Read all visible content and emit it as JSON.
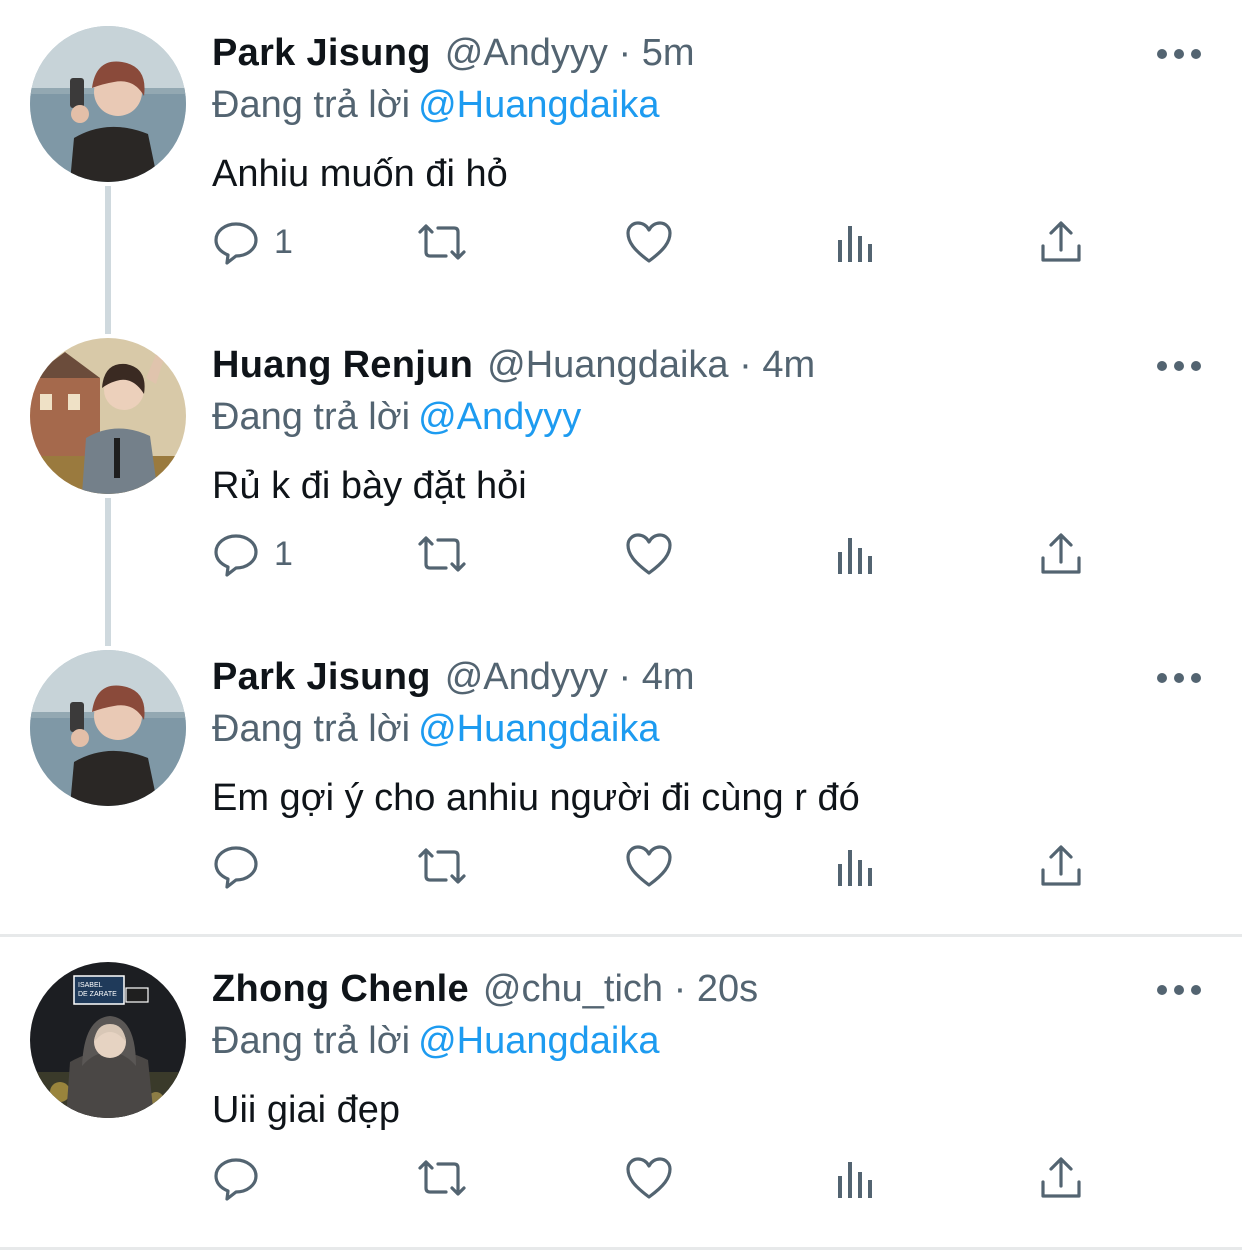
{
  "colors": {
    "accent": "#1d9bf0",
    "secondary_text": "#536471",
    "primary_text": "#0f1419",
    "thread_line": "#cfd9de"
  },
  "tweets": [
    {
      "name": "Park Jisung",
      "handle": "@Andyyy",
      "dot": "·",
      "time": "5m",
      "reply_label": "Đang trả lời",
      "reply_to": "@Huangdaika",
      "text": "Anhiu muốn đi hỏ",
      "reply_count": "1"
    },
    {
      "name": "Huang Renjun",
      "handle": "@Huangdaika",
      "dot": "·",
      "time": "4m",
      "reply_label": "Đang trả lời",
      "reply_to": "@Andyyy",
      "text": "Rủ k đi bày đặt hỏi",
      "reply_count": "1"
    },
    {
      "name": "Park Jisung",
      "handle": "@Andyyy",
      "dot": "·",
      "time": "4m",
      "reply_label": "Đang trả lời",
      "reply_to": "@Huangdaika",
      "text": "Em gợi ý cho anhiu người đi cùng r đó",
      "reply_count": ""
    },
    {
      "name": "Zhong Chenle",
      "handle": "@chu_tich",
      "dot": "·",
      "time": "20s",
      "reply_label": "Đang trả lời",
      "reply_to": "@Huangdaika",
      "text": "Uii giai đẹp",
      "reply_count": "",
      "avatar_sign": {
        "line1": "ISABEL",
        "line2": "DE ZARATE"
      }
    }
  ],
  "icons": [
    "reply-icon",
    "retweet-icon",
    "like-icon",
    "analytics-icon",
    "share-icon",
    "more-icon"
  ]
}
